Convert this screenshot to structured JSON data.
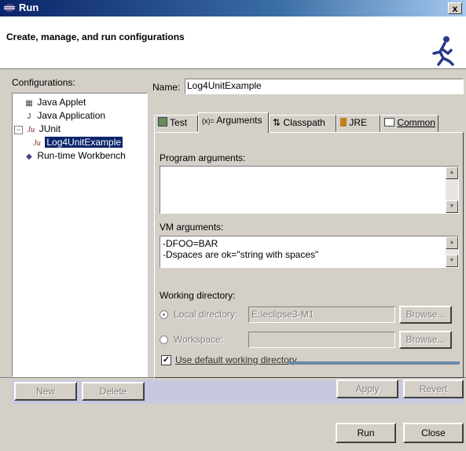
{
  "window": {
    "title": "Run",
    "close": "x"
  },
  "banner": {
    "text": "Create, manage, and run configurations"
  },
  "configurations": {
    "label": "Configurations:",
    "items": [
      {
        "label": "Java Applet",
        "icon": "applet-icon"
      },
      {
        "label": "Java Application",
        "icon": "java-app-icon",
        "glyph": "J"
      },
      {
        "label": "JUnit",
        "icon": "junit-icon",
        "glyph": "Ju"
      },
      {
        "label": "Log4UnitExample",
        "icon": "junit-icon",
        "glyph": "Ju",
        "selected": true
      },
      {
        "label": "Run-time Workbench",
        "icon": "workbench-icon"
      }
    ],
    "new_label": "New",
    "delete_label": "Delete"
  },
  "name": {
    "label": "Name:",
    "value": "Log4UnitExample"
  },
  "tabs": [
    {
      "label": "Test",
      "icon": "test-icon"
    },
    {
      "label": "Arguments",
      "icon": "arguments-icon",
      "glyph": "(x)=",
      "active": true
    },
    {
      "label": "Classpath",
      "icon": "classpath-icon",
      "glyph": "⇅"
    },
    {
      "label": "JRE",
      "icon": "jre-icon"
    },
    {
      "label": "Common",
      "icon": "common-icon"
    }
  ],
  "arguments": {
    "program_label": "Program arguments:",
    "program_value": "",
    "vm_label": "VM arguments:",
    "vm_lines": [
      "-DFOO=BAR",
      "-Dspaces are ok=\"string with spaces\""
    ],
    "workdir_label": "Working directory:",
    "local_dir_label": "Local directory:",
    "local_dir_value": "E:\\eclipse3-M1",
    "browse_label": "Browse...",
    "workspace_label": "Workspace:",
    "workspace_value": "",
    "browse2_label": "Browse...",
    "default_dir_label": "Use default working directory"
  },
  "actions": {
    "apply": "Apply",
    "revert": "Revert",
    "run": "Run",
    "close": "Close"
  }
}
